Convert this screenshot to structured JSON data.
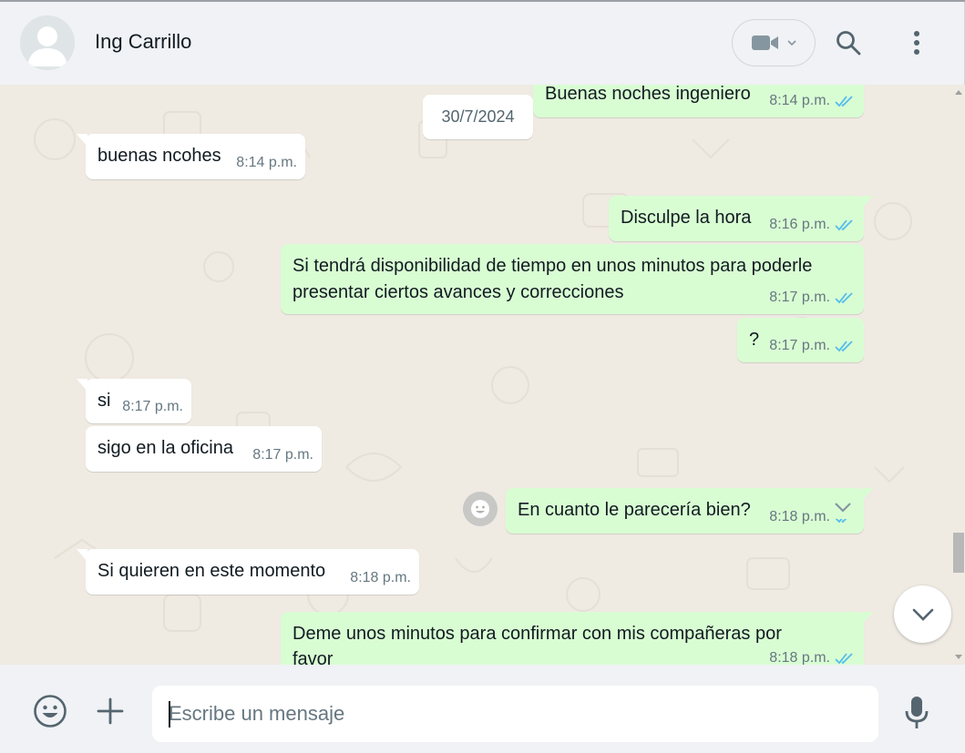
{
  "header": {
    "contact_name": "Ing Carrillo",
    "video_icon": "video-camera-icon",
    "search_icon": "search-icon",
    "menu_icon": "vertical-dots-icon"
  },
  "chat": {
    "date_separator": "30/7/2024",
    "messages": [
      {
        "direction": "out",
        "text": "Buenas noches ingeniero",
        "time": "8:14 p.m.",
        "status": "read"
      },
      {
        "direction": "in",
        "text": "buenas ncohes",
        "time": "8:14 p.m."
      },
      {
        "direction": "out",
        "text": "Disculpe la hora",
        "time": "8:16 p.m.",
        "status": "read"
      },
      {
        "direction": "out",
        "text": "Si tendrá disponibilidad de tiempo en unos minutos para poderle presentar ciertos avances y correcciones",
        "time": "8:17 p.m.",
        "status": "read"
      },
      {
        "direction": "out",
        "text": "?",
        "time": "8:17 p.m.",
        "status": "read"
      },
      {
        "direction": "in",
        "text": "si",
        "time": "8:17 p.m."
      },
      {
        "direction": "in",
        "text": "sigo en la oficina",
        "time": "8:17 p.m."
      },
      {
        "direction": "out",
        "text": "En cuanto le parecería bien?",
        "time": "8:18 p.m.",
        "status": "read"
      },
      {
        "direction": "in",
        "text": "Si quieren en este momento",
        "time": "8:18 p.m."
      },
      {
        "direction": "out",
        "text": "Deme unos minutos para confirmar con mis compañeras por favor",
        "time": "8:18 p.m.",
        "status": "read"
      }
    ]
  },
  "footer": {
    "input_placeholder": "Escribe un mensaje",
    "input_value": ""
  },
  "colors": {
    "outgoing_bubble": "#d9fdd3",
    "incoming_bubble": "#ffffff",
    "chat_background": "#efeae2",
    "read_tick": "#53bdeb"
  }
}
